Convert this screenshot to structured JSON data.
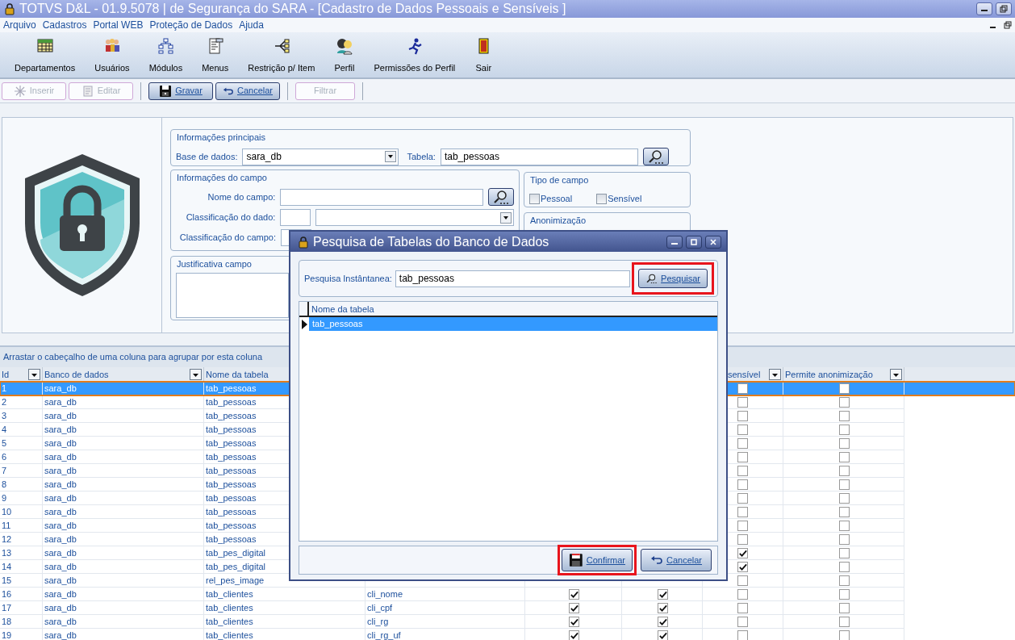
{
  "window": {
    "title": "TOTVS D&L - 01.9.5078 | de Segurança do SARA - [Cadastro de Dados Pessoais e Sensíveis ]"
  },
  "menu": [
    "Arquivo",
    "Cadastros",
    "Portal WEB",
    "Proteção de Dados",
    "Ajuda"
  ],
  "toolbar": [
    "Departamentos",
    "Usuários",
    "Módulos",
    "Menus",
    "Restrição p/ Item",
    "Perfil",
    "Permissões do Perfil",
    "Sair"
  ],
  "actions": [
    {
      "label": "Inserir",
      "disabled": true
    },
    {
      "label": "Editar",
      "disabled": true
    },
    {
      "label": "Gravar",
      "disabled": false
    },
    {
      "label": "Cancelar",
      "disabled": false
    },
    {
      "label": "Filtrar",
      "disabled": true
    }
  ],
  "form": {
    "main": {
      "legend": "Informações principais",
      "database_label": "Base de dados:",
      "database_value": "sara_db",
      "table_label": "Tabela:",
      "table_value": "tab_pessoas"
    },
    "field_info": {
      "legend": "Informações do campo",
      "name_label": "Nome do campo:",
      "data_class_label": "Classificação do dado:",
      "field_class_label": "Classificação do campo:"
    },
    "field_type": {
      "legend": "Tipo de campo",
      "options": [
        {
          "label": "Pessoal",
          "checked": false
        },
        {
          "label": "Sensível",
          "checked": false
        }
      ]
    },
    "anonymization": {
      "legend": "Anonimização"
    },
    "justification": {
      "legend": "Justificativa campo"
    }
  },
  "grid": {
    "group_hint": "Arrastar o cabeçalho de uma coluna para agrupar por esta coluna",
    "columns": [
      "Id",
      "Banco de dados",
      "Nome da tabela",
      "sensível",
      "Permite anonimização"
    ],
    "rows": [
      {
        "id": "1",
        "database": "sara_db",
        "table": "tab_pessoas",
        "selected": true,
        "sensitive": false,
        "anonymizable": false
      },
      {
        "id": "2",
        "database": "sara_db",
        "table": "tab_pessoas",
        "selected": false,
        "sensitive": false,
        "anonymizable": false
      },
      {
        "id": "3",
        "database": "sara_db",
        "table": "tab_pessoas",
        "selected": false,
        "sensitive": false,
        "anonymizable": false
      },
      {
        "id": "4",
        "database": "sara_db",
        "table": "tab_pessoas",
        "selected": false,
        "sensitive": false,
        "anonymizable": false
      },
      {
        "id": "5",
        "database": "sara_db",
        "table": "tab_pessoas",
        "selected": false,
        "sensitive": false,
        "anonymizable": false
      },
      {
        "id": "6",
        "database": "sara_db",
        "table": "tab_pessoas",
        "selected": false,
        "sensitive": false,
        "anonymizable": false
      },
      {
        "id": "7",
        "database": "sara_db",
        "table": "tab_pessoas",
        "selected": false,
        "sensitive": false,
        "anonymizable": false
      },
      {
        "id": "8",
        "database": "sara_db",
        "table": "tab_pessoas",
        "selected": false,
        "sensitive": false,
        "anonymizable": false
      },
      {
        "id": "9",
        "database": "sara_db",
        "table": "tab_pessoas",
        "selected": false,
        "sensitive": false,
        "anonymizable": false
      },
      {
        "id": "10",
        "database": "sara_db",
        "table": "tab_pessoas",
        "selected": false,
        "sensitive": false,
        "anonymizable": false
      },
      {
        "id": "11",
        "database": "sara_db",
        "table": "tab_pessoas",
        "selected": false,
        "sensitive": false,
        "anonymizable": false
      },
      {
        "id": "12",
        "database": "sara_db",
        "table": "tab_pessoas",
        "selected": false,
        "sensitive": false,
        "anonymizable": false
      },
      {
        "id": "13",
        "database": "sara_db",
        "table": "tab_pes_digital",
        "selected": false,
        "sensitive": true,
        "anonymizable": false
      },
      {
        "id": "14",
        "database": "sara_db",
        "table": "tab_pes_digital",
        "selected": false,
        "sensitive": true,
        "anonymizable": false
      },
      {
        "id": "15",
        "database": "sara_db",
        "table": "rel_pes_image",
        "selected": false,
        "sensitive": false,
        "anonymizable": false
      },
      {
        "id": "16",
        "database": "sara_db",
        "table": "tab_clientes",
        "column_4": "cli_nome",
        "column_5": true,
        "column_6": true,
        "selected": false,
        "sensitive": false,
        "anonymizable": false
      },
      {
        "id": "17",
        "database": "sara_db",
        "table": "tab_clientes",
        "column_4": "cli_cpf",
        "column_5": true,
        "column_6": true,
        "selected": false,
        "sensitive": false,
        "anonymizable": false
      },
      {
        "id": "18",
        "database": "sara_db",
        "table": "tab_clientes",
        "column_4": "cli_rg",
        "column_5": true,
        "column_6": true,
        "selected": false,
        "sensitive": false,
        "anonymizable": false
      },
      {
        "id": "19",
        "database": "sara_db",
        "table": "tab_clientes",
        "column_4": "cli_rg_uf",
        "column_5": true,
        "column_6": true,
        "selected": false,
        "sensitive": false,
        "anonymizable": false
      }
    ]
  },
  "dialog": {
    "title": "Pesquisa de Tabelas do Banco de Dados",
    "search_label": "Pesquisa Instântanea:",
    "search_value": "tab_pessoas",
    "search_button": {
      "label": "Pesquisar",
      "highlighted": true
    },
    "column": "Nome da tabela",
    "rows": [
      {
        "name": "tab_pessoas",
        "selected": true
      }
    ],
    "buttons": [
      {
        "label": "Confirmar",
        "highlighted": true
      },
      {
        "label": "Cancelar",
        "highlighted": false
      }
    ]
  }
}
